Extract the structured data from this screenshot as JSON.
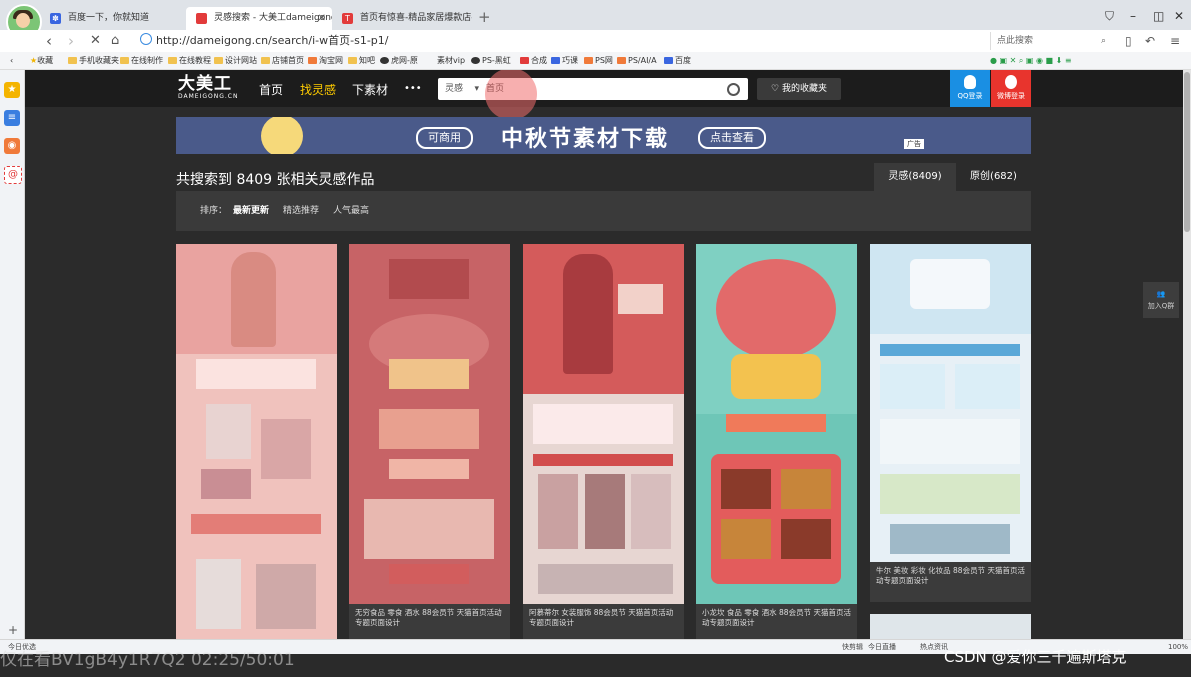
{
  "browser": {
    "tabs": [
      {
        "label": "百度一下，你就知道",
        "icon_color": "#3a66e0"
      },
      {
        "label": "灵感搜索 - 大美工dameigong.c",
        "icon_color": "#e23b3b"
      },
      {
        "label": "首页有惊喜-精品家居爆款店-淘",
        "icon_color": "#e23b3b",
        "icon_text": "T"
      }
    ],
    "url": "http://dameigong.cn/search/i-w首页-s1-p1/",
    "search_placeholder": "点此搜索",
    "bookmarks": [
      "收藏",
      "手机收藏夹",
      "在线制作",
      "在线教程",
      "设计网站",
      "店铺首页",
      "淘宝网",
      "知吧",
      "虎网-原",
      "素材vip",
      "PS-黑虹",
      "合成",
      "巧课",
      "PS网",
      "PS/AI/A",
      "百度"
    ]
  },
  "site": {
    "logo_main": "大美工",
    "logo_sub": "DAMEIGONG.CN",
    "nav": [
      "首页",
      "找灵感",
      "下素材",
      "•••"
    ],
    "search_category": "灵感",
    "search_query": "首页",
    "favorites_label": "我的收藏夹",
    "qq_login": "QQ登录",
    "weibo_login": "微博登录",
    "banner": {
      "pill_left": "可商用",
      "title": "中秋节素材下载",
      "pill_right": "点击查看",
      "ad": "广告"
    },
    "result_text": "共搜索到 8409 张相关灵感作品",
    "result_tabs": [
      "灵感(8409)",
      "原创(682)"
    ],
    "sort_label": "排序：",
    "sort_options": [
      "最新更新",
      "精选推荐",
      "人气最高"
    ],
    "cards": [
      {
        "caption": "",
        "bg": "#e9a3a0"
      },
      {
        "caption": "无穷食品 零食 酒水 88会员节 天猫首页活动专题页面设计",
        "bg": "#c76366"
      },
      {
        "caption": "阿慕蒂尔 女装服饰 88会员节 天猫首页活动专题页面设计",
        "bg": "#d45b5b"
      },
      {
        "caption": "小龙坎 食品 零食 酒水 88会员节 天猫首页活动专题页面设计",
        "bg": "#6ec6b7"
      },
      {
        "caption": "牛尔 美妆 彩妆 化妆品 88会员节 天猫首页活动专题页面设计",
        "bg": "#cfe6f2"
      }
    ],
    "join_qq": "加入Q群"
  },
  "statusbar": {
    "left": "今日优选",
    "items": [
      "快剪辑",
      "今日直播",
      "热点资讯"
    ],
    "zoom": "100%"
  },
  "overlay": {
    "left_text": "仅在看BV1gB4y1R7Q2 02:25/50:01",
    "watermark": "CSDN @爱你三千遍斯塔克"
  }
}
